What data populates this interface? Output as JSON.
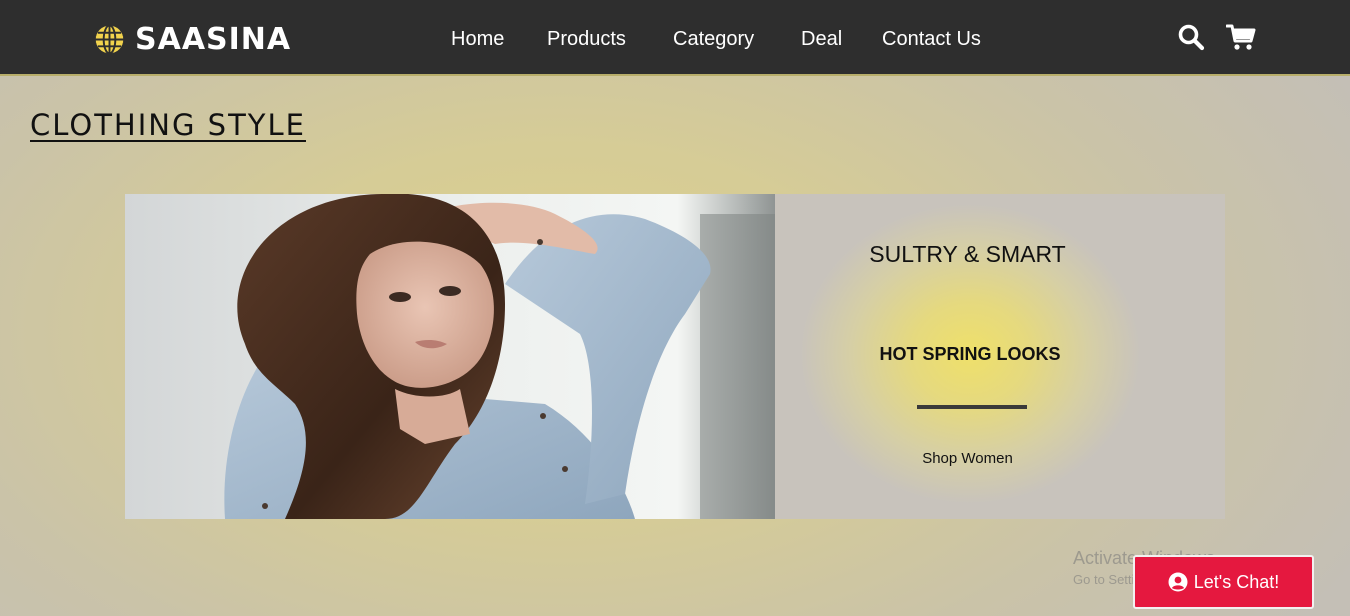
{
  "header": {
    "brand": "SAASINA",
    "nav": [
      {
        "label": "Home"
      },
      {
        "label": "Products"
      },
      {
        "label": "Category"
      },
      {
        "label": "Deal"
      },
      {
        "label": "Contact Us"
      }
    ],
    "icons": {
      "search": "search-icon",
      "cart": "cart-icon",
      "logo": "globe-icon"
    }
  },
  "main": {
    "title": "CLOTHING STYLE",
    "banner": {
      "heading": "SULTRY & SMART",
      "subheading": "HOT SPRING LOOKS",
      "link": "Shop Women"
    }
  },
  "overlay": {
    "watermark_title": "Activate Windows",
    "watermark_sub": "Go to Settings to activate Windows.",
    "chat_label": "Let's Chat!"
  },
  "colors": {
    "navbar": "#2e2e2e",
    "brand_accent": "#f2d34d",
    "chat_button": "#e5183f",
    "panel_glow": "#efe06a"
  }
}
